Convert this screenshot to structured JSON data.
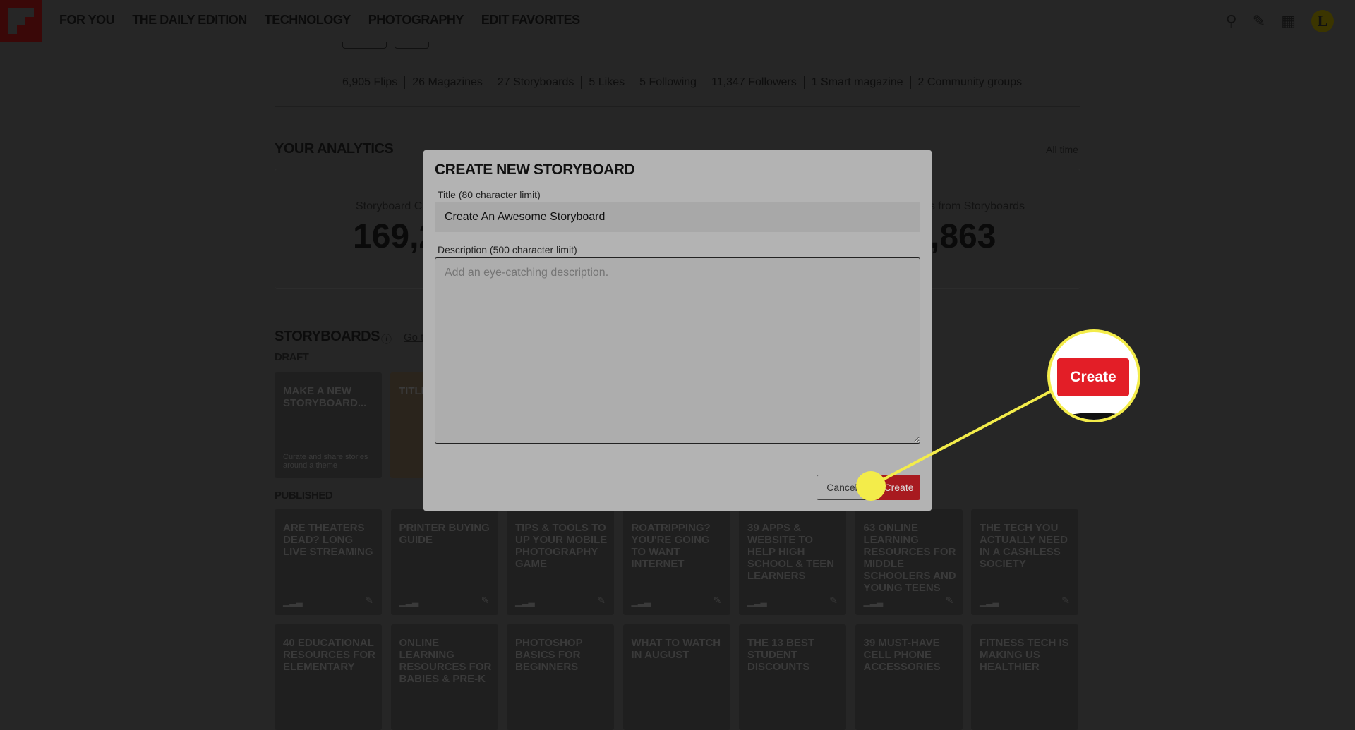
{
  "nav": {
    "items": [
      "FOR YOU",
      "THE DAILY EDITION",
      "TECHNOLOGY",
      "PHOTOGRAPHY",
      "EDIT FAVORITES"
    ],
    "avatar_letter": "L"
  },
  "icons": [
    "search-icon",
    "pencil-icon",
    "grid-icon",
    "avatar"
  ],
  "stats": [
    "6,905 Flips",
    "26 Magazines",
    "27 Storyboards",
    "5 Likes",
    "5 Following",
    "11,347 Followers",
    "1 Smart magazine",
    "2 Community groups"
  ],
  "analytics": {
    "title": "YOUR ANALYTICS",
    "range": "All time",
    "left_label": "Storyboard C",
    "left_value": "169,2",
    "right_label": "us from Storyboards",
    "right_value": ",863"
  },
  "storyboards": {
    "title": "STORYBOARDS",
    "link": "Go t",
    "draft_label": "DRAFT",
    "published_label": "PUBLISHED",
    "drafts": [
      {
        "title": "MAKE A NEW STORYBOARD...",
        "desc": "Curate and share stories around a theme"
      },
      {
        "title": "TITLE AWE STOR",
        "desc": ""
      }
    ],
    "published": [
      "ARE THEATERS DEAD? LONG LIVE STREAMING",
      "PRINTER BUYING GUIDE",
      "TIPS & TOOLS TO UP YOUR MOBILE PHOTOGRAPHY GAME",
      "ROATRIPPING? YOU'RE GOING TO WANT INTERNET",
      "39 APPS & WEBSITE TO HELP HIGH SCHOOL & TEEN LEARNERS",
      "63 ONLINE LEARNING RESOURCES FOR MIDDLE SCHOOLERS AND YOUNG TEENS",
      "THE TECH YOU ACTUALLY NEED IN A CASHLESS SOCIETY"
    ],
    "row2": [
      "40 EDUCATIONAL RESOURCES FOR ELEMENTARY",
      "ONLINE LEARNING RESOURCES FOR BABIES & PRE-K",
      "PHOTOSHOP BASICS FOR BEGINNERS",
      "WHAT TO WATCH IN AUGUST",
      "THE 13 BEST STUDENT DISCOUNTS",
      "39 MUST-HAVE CELL PHONE ACCESSORIES",
      "FITNESS TECH IS MAKING US HEALTHIER"
    ]
  },
  "modal": {
    "title": "CREATE NEW STORYBOARD",
    "title_label": "Title (80 character limit)",
    "title_value": "Create An Awesome Storyboard",
    "desc_label": "Description (500 character limit)",
    "desc_placeholder": "Add an eye-catching description.",
    "cancel": "Cancel",
    "create": "Create"
  },
  "callout": {
    "label": "Create",
    "color": "#f3ec4a",
    "button_color": "#e31e27"
  }
}
